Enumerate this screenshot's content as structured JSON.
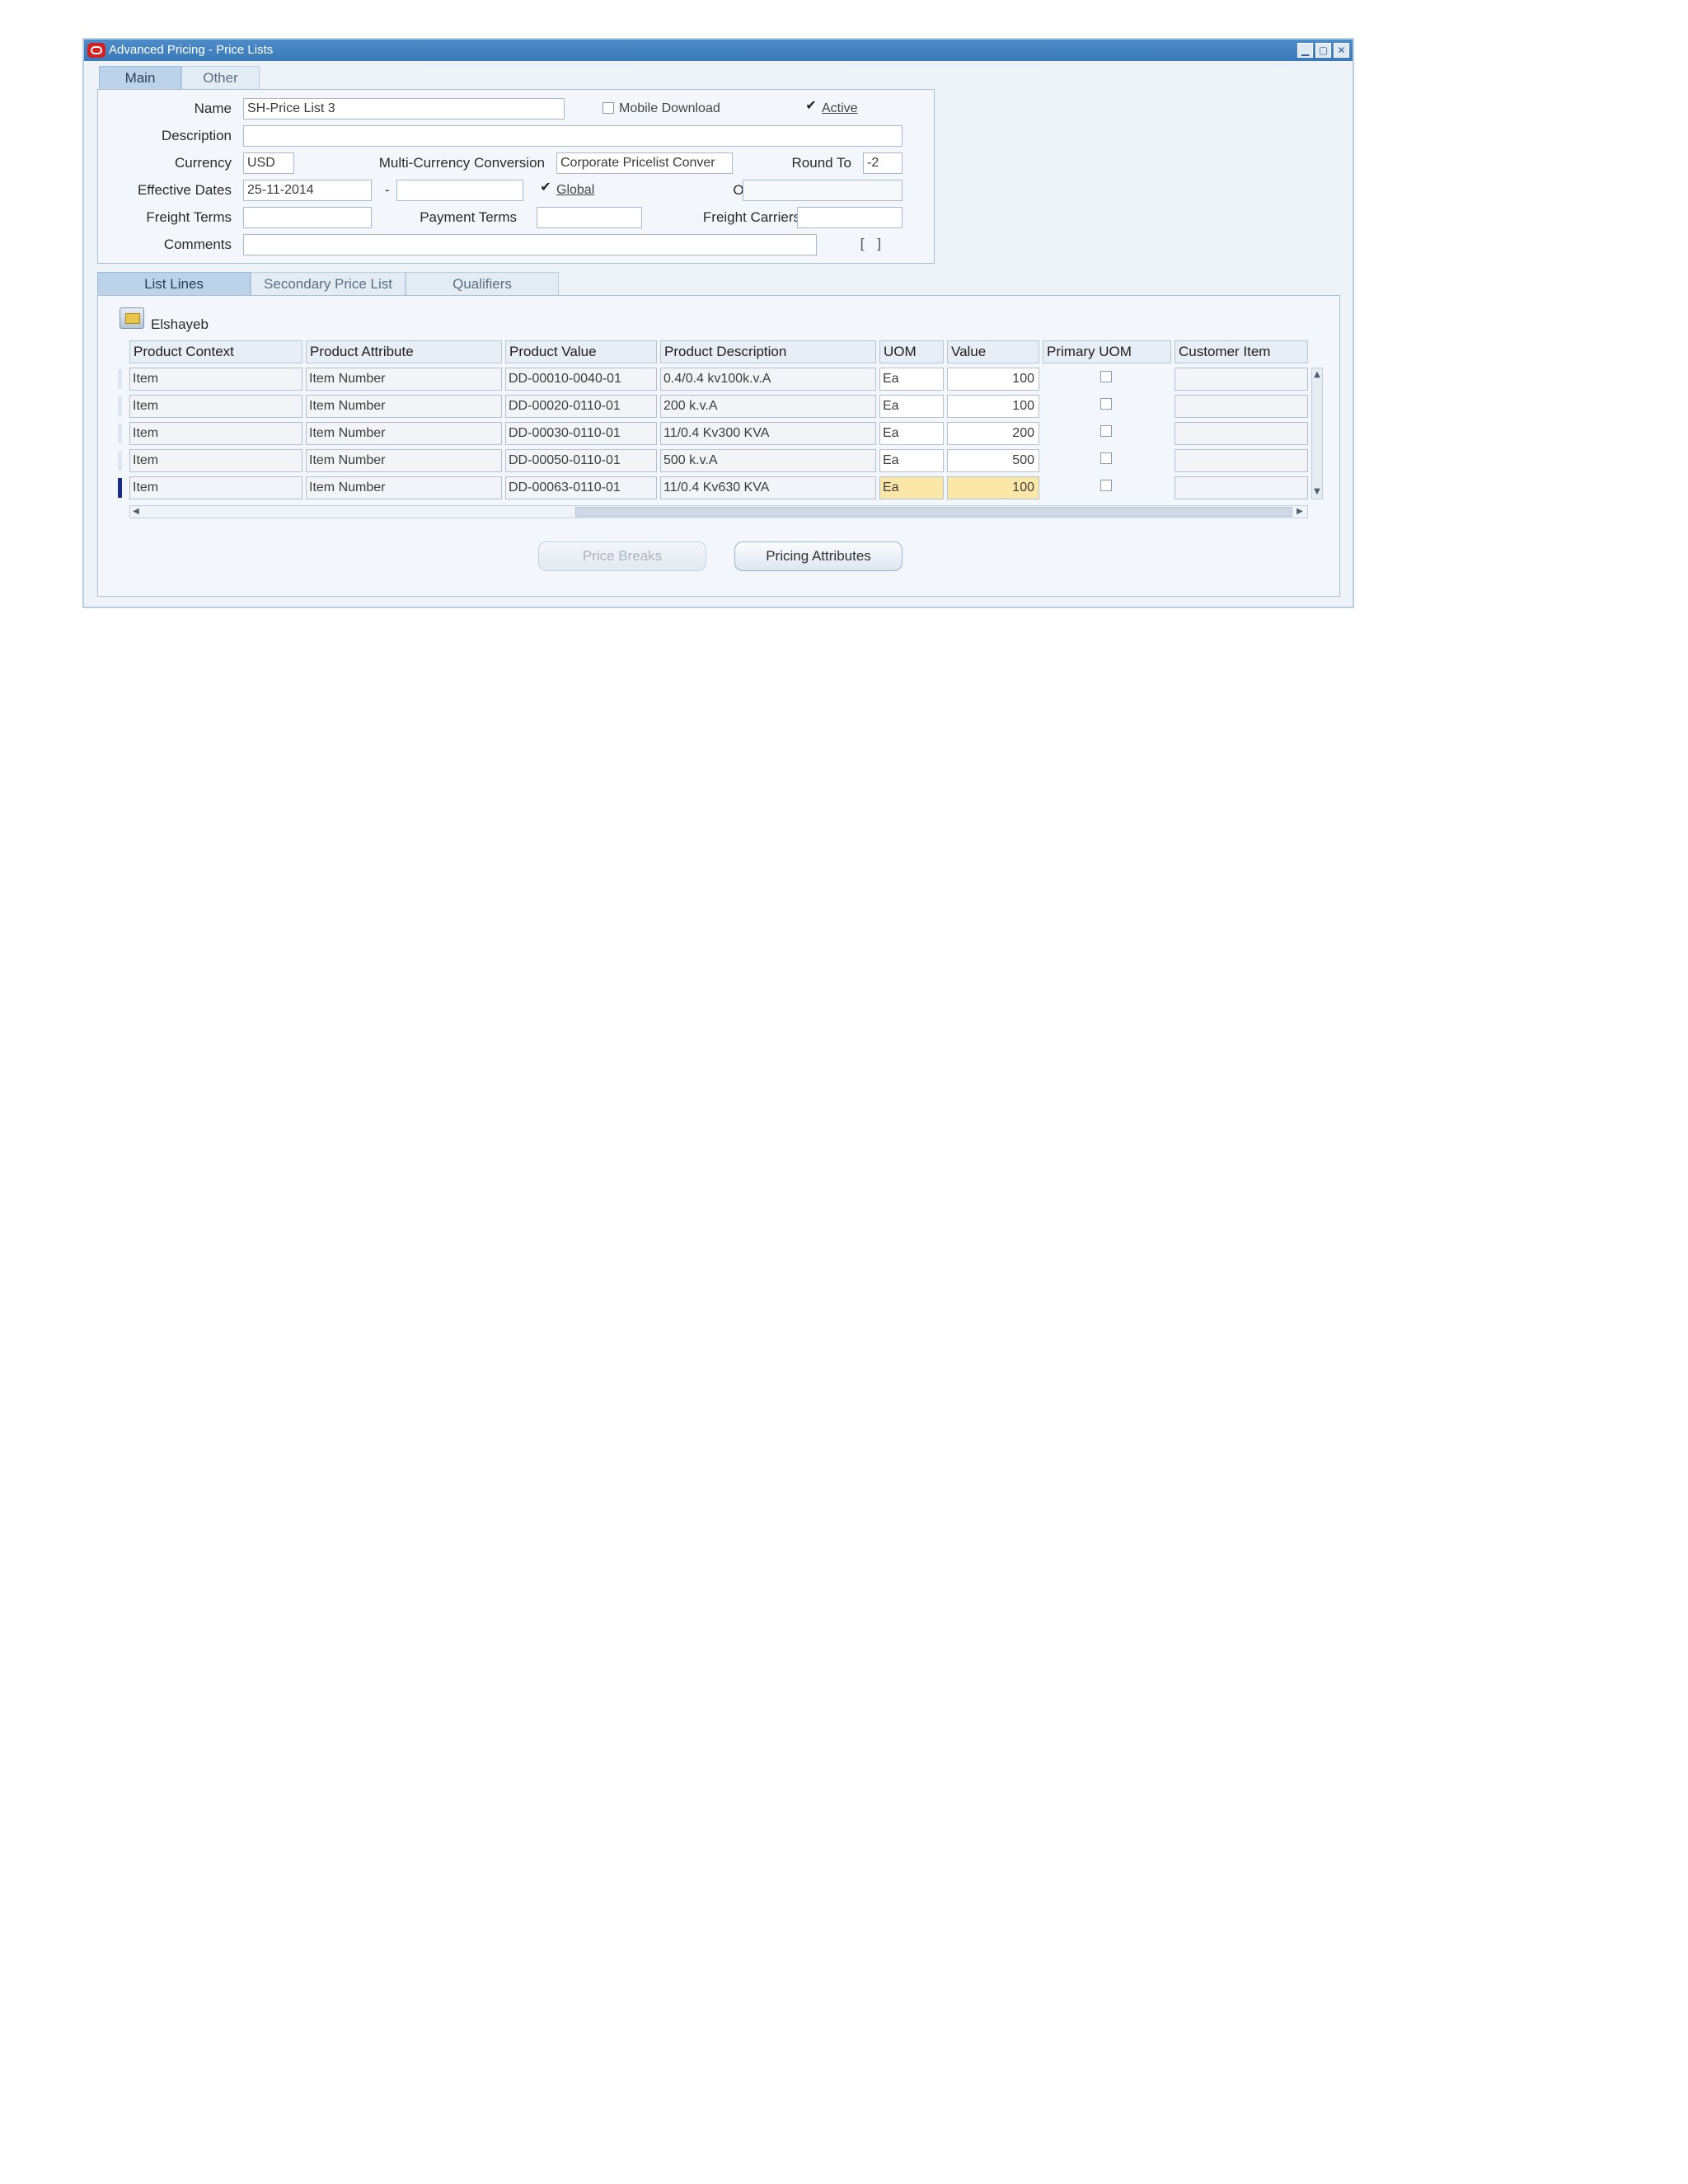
{
  "window": {
    "title": "Advanced Pricing - Price Lists",
    "controls": [
      "▁",
      "▢",
      "✕"
    ]
  },
  "top_tabs": [
    {
      "label": "Main",
      "active": true
    },
    {
      "label": "Other",
      "active": false
    }
  ],
  "header": {
    "name_label": "Name",
    "name_value": "SH-Price List 3",
    "mobile_download": {
      "label": "Mobile Download",
      "checked": false
    },
    "active": {
      "label": "Active",
      "checked": true
    },
    "description_label": "Description",
    "description_value": "",
    "currency_label": "Currency",
    "currency_value": "USD",
    "multi_currency_label": "Multi-Currency Conversion",
    "multi_currency_value": "Corporate Pricelist Conver",
    "round_to_label": "Round To",
    "round_to_value": "-2",
    "effective_dates_label": "Effective Dates",
    "effective_from": "25-11-2014",
    "date_separator": "-",
    "effective_to": "",
    "global": {
      "label": "Global",
      "checked": true
    },
    "operating_unit_label": "Operating Unit",
    "operating_unit_value": "",
    "freight_terms_label": "Freight Terms",
    "freight_terms_value": "",
    "payment_terms_label": "Payment Terms",
    "payment_terms_value": "",
    "freight_carriers_label": "Freight Carriers",
    "freight_carriers_value": "",
    "comments_label": "Comments",
    "comments_value": "",
    "flex_field": "[ ]"
  },
  "lower_tabs": [
    {
      "label": "List Lines",
      "active": true
    },
    {
      "label": "Secondary Price List",
      "active": false
    },
    {
      "label": "Qualifiers",
      "active": false
    }
  ],
  "list_lines": {
    "folder_label": "Elshayeb",
    "columns": [
      "Product Context",
      "Product Attribute",
      "Product Value",
      "Product Description",
      "UOM",
      "Value",
      "Primary UOM",
      "Customer Item"
    ],
    "rows": [
      {
        "context": "Item",
        "attribute": "Item Number",
        "product_value": "DD-00010-0040-01",
        "description": "0.4/0.4 kv100k.v.A",
        "uom": "Ea",
        "value": "100",
        "primary_uom": false,
        "customer_item": "",
        "current": false
      },
      {
        "context": "Item",
        "attribute": "Item Number",
        "product_value": "DD-00020-0110-01",
        "description": "200 k.v.A",
        "uom": "Ea",
        "value": "100",
        "primary_uom": false,
        "customer_item": "",
        "current": false
      },
      {
        "context": "Item",
        "attribute": "Item Number",
        "product_value": "DD-00030-0110-01",
        "description": "11/0.4 Kv300 KVA",
        "uom": "Ea",
        "value": "200",
        "primary_uom": false,
        "customer_item": "",
        "current": false
      },
      {
        "context": "Item",
        "attribute": "Item Number",
        "product_value": "DD-00050-0110-01",
        "description": "500 k.v.A",
        "uom": "Ea",
        "value": "500",
        "primary_uom": false,
        "customer_item": "",
        "current": false
      },
      {
        "context": "Item",
        "attribute": "Item Number",
        "product_value": "DD-00063-0110-01",
        "description": "11/0.4 Kv630 KVA",
        "uom": "Ea",
        "value": "100",
        "primary_uom": false,
        "customer_item": "",
        "current": true
      }
    ]
  },
  "buttons": {
    "price_breaks": "Price Breaks",
    "pricing_attributes": "Pricing Attributes"
  },
  "colors": {
    "title_bar": "#3b7ab8",
    "current_field": "#fbe8a8",
    "row_indicator": "#1a2d8a"
  }
}
